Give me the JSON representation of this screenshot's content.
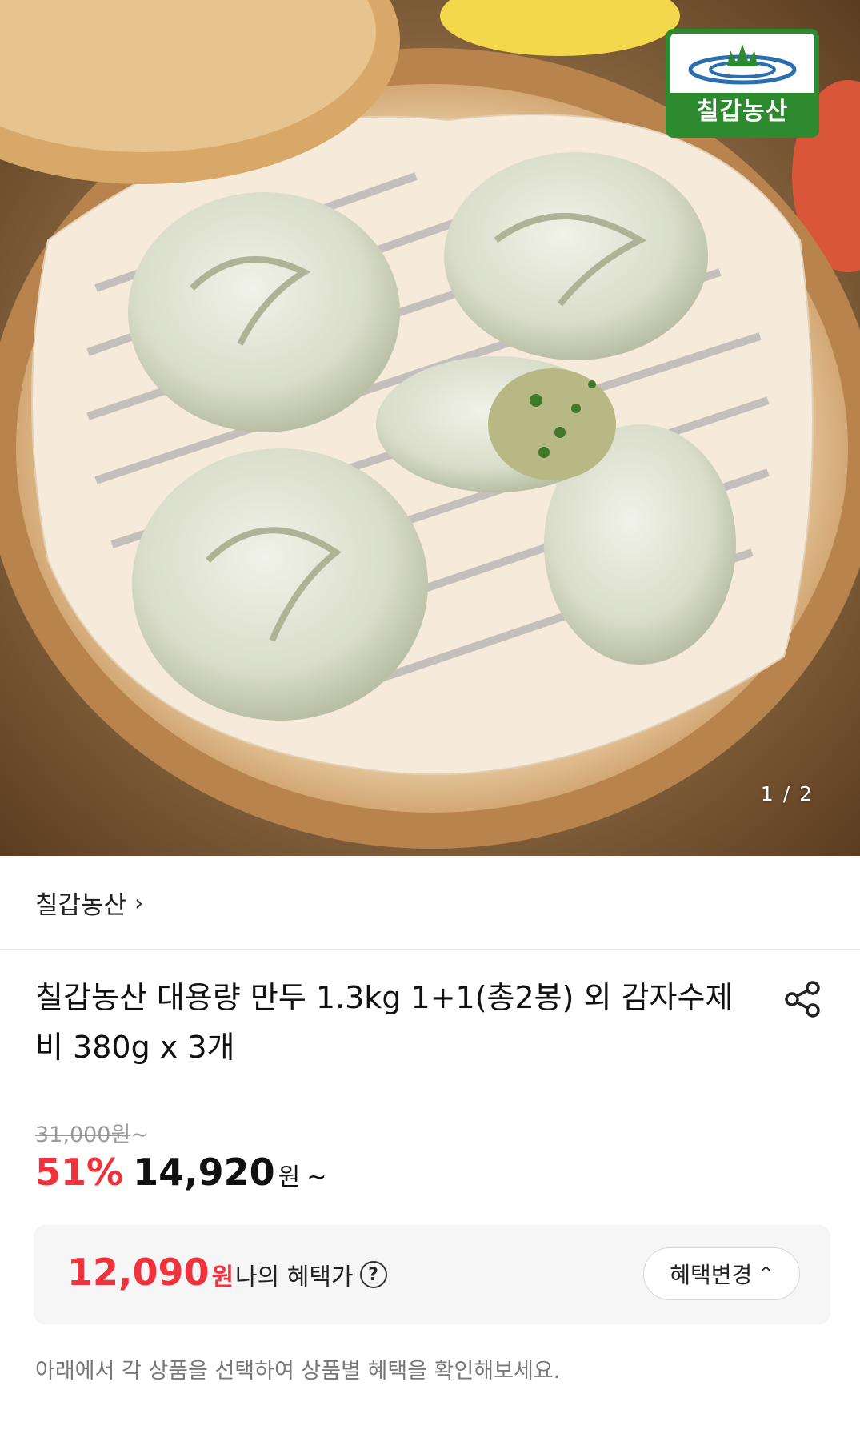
{
  "hero": {
    "page_current": "1",
    "page_separator": "/",
    "page_total": "2",
    "brand_logo_text": "칠갑농산"
  },
  "seller": {
    "name": "칠갑농산",
    "chevron": "›"
  },
  "product": {
    "title": "칠갑농산 대용량 만두 1.3kg 1+1(총2봉) 외 감자수제비 380g x 3개",
    "share_icon": "share-icon"
  },
  "price": {
    "original": "31,000원",
    "original_suffix": "~",
    "discount": "51%",
    "sale": "14,920",
    "sale_unit": "원",
    "sale_suffix": "~"
  },
  "benefit": {
    "price": "12,090",
    "unit": "원",
    "label": "나의 혜택가",
    "help_icon": "?",
    "change_button": "혜택변경",
    "change_chevron": "^"
  },
  "notice": "아래에서 각 상품을 선택하여 상품별 혜택을 확인해보세요.",
  "colors": {
    "accent_red": "#f0323c",
    "logo_green": "#2d8a2f"
  }
}
